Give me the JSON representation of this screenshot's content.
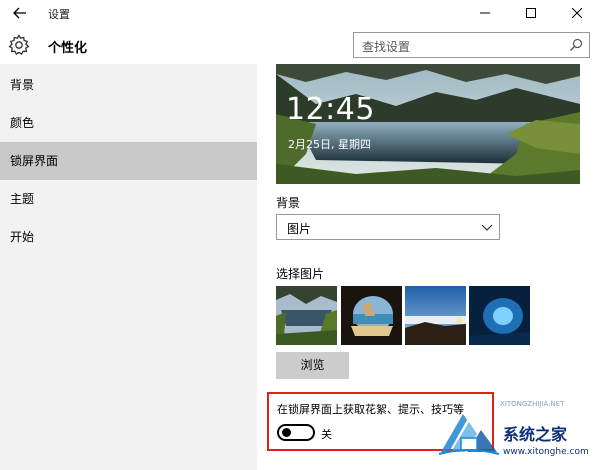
{
  "window": {
    "title": "设置",
    "controls": {
      "minimize": "minimize-icon",
      "maximize": "maximize-icon",
      "close": "close-icon"
    }
  },
  "header": {
    "title": "个性化",
    "search_placeholder": "查找设置"
  },
  "sidebar": {
    "items": [
      {
        "label": "背景",
        "selected": false
      },
      {
        "label": "颜色",
        "selected": false
      },
      {
        "label": "锁屏界面",
        "selected": true
      },
      {
        "label": "主题",
        "selected": false
      },
      {
        "label": "开始",
        "selected": false
      }
    ]
  },
  "lockscreen": {
    "preview_time": "12:45",
    "preview_date": "2月25日, 星期四",
    "background_label": "背景",
    "background_value": "图片",
    "choose_picture_label": "选择图片",
    "thumbnails": [
      "lake-mountains",
      "beach-cave-arch",
      "sea-cloud-sunset",
      "ice-cave-blue"
    ],
    "browse_label": "浏览",
    "tips_label": "在锁屏界面上获取花絮、提示、技巧等",
    "tips_toggle_state": "关",
    "tips_toggle_on": false
  },
  "watermark": {
    "brand": "系统之家",
    "url": "www.xitonghe.com",
    "sub_url": "XITONGZHIJIA.NET"
  },
  "colors": {
    "sidebar_bg": "#f2f2f2",
    "selected_bg": "#c9c9c9",
    "highlight_border": "#e0211b",
    "watermark_blue": "#0c2f7a"
  }
}
